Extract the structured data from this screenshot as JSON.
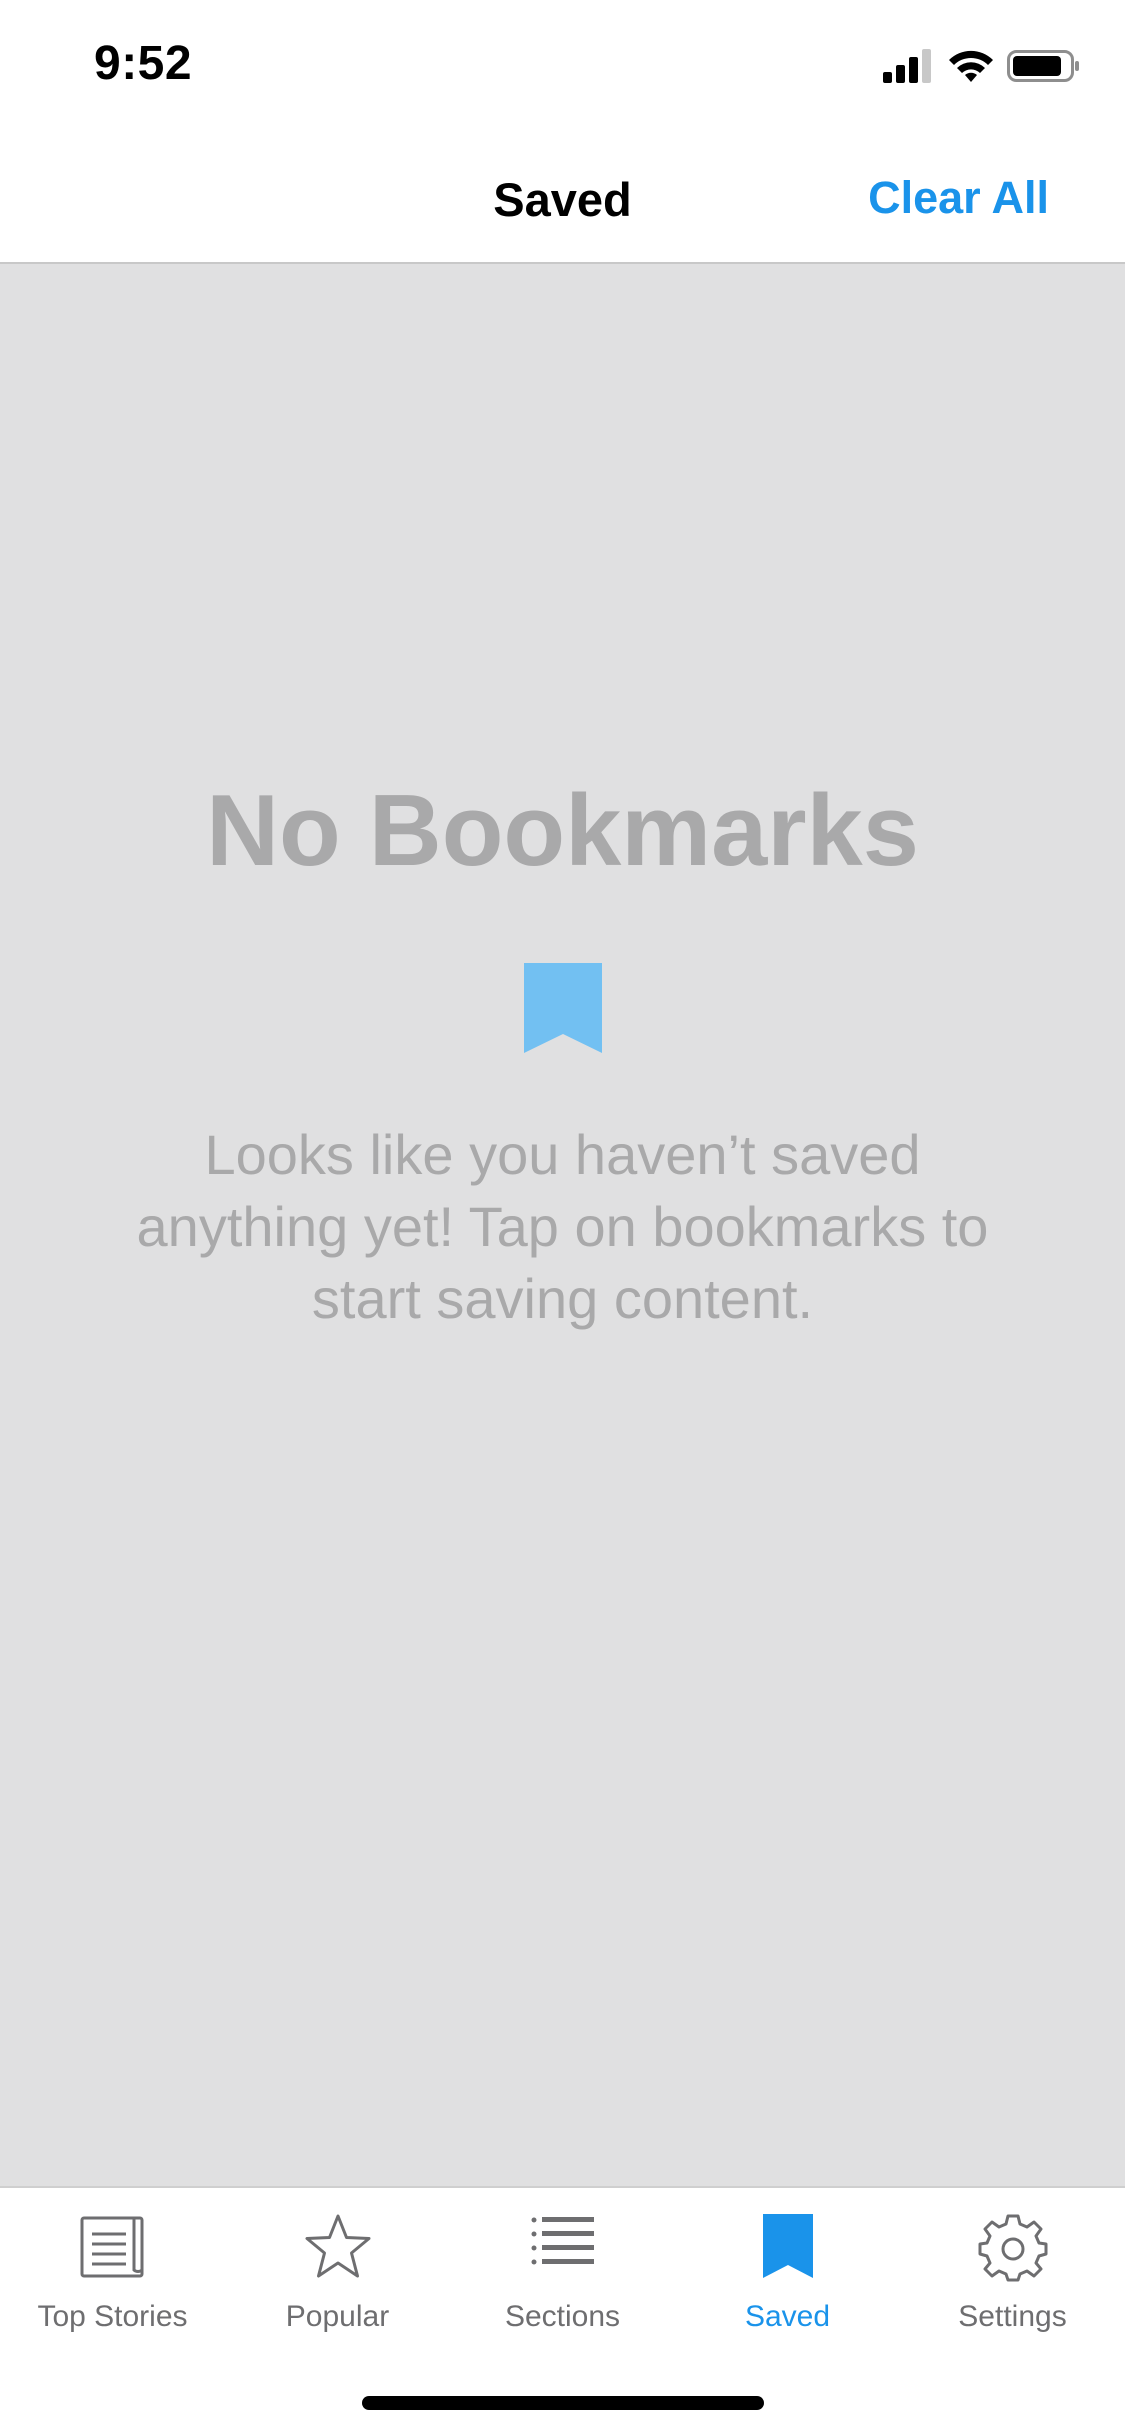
{
  "status_bar": {
    "time": "9:52"
  },
  "nav": {
    "title": "Saved",
    "action_label": "Clear All"
  },
  "empty_state": {
    "title": "No Bookmarks",
    "message": "Looks like you haven’t saved anything yet! Tap on bookmarks to start saving content.",
    "icon": "bookmark-icon"
  },
  "tabs": [
    {
      "label": "Top Stories",
      "icon": "newspaper-icon",
      "active": false
    },
    {
      "label": "Popular",
      "icon": "star-icon",
      "active": false
    },
    {
      "label": "Sections",
      "icon": "list-icon",
      "active": false
    },
    {
      "label": "Saved",
      "icon": "bookmark-icon",
      "active": true
    },
    {
      "label": "Settings",
      "icon": "gear-icon",
      "active": false
    }
  ],
  "colors": {
    "accent": "#1a93ea",
    "empty_icon": "#72c0f2",
    "content_background": "#e0e0e1",
    "muted_text": "#a9a9aa",
    "tab_inactive": "#6e6e70"
  }
}
